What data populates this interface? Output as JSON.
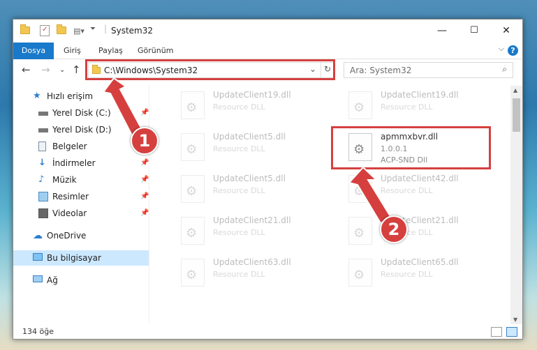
{
  "window": {
    "title": "System32",
    "minimize": "—",
    "maximize": "☐",
    "close": "✕"
  },
  "ribbon": {
    "tabs": [
      "Dosya",
      "Giriş",
      "Paylaş",
      "Görünüm"
    ],
    "help": "?"
  },
  "address": {
    "path": "C:\\Windows\\System32",
    "search_placeholder": "Ara: System32"
  },
  "sidebar": {
    "items": [
      {
        "label": "Hızlı erişim",
        "icon": "star-icon"
      },
      {
        "label": "Yerel Disk (C:)",
        "icon": "drive-icon",
        "pinned": true
      },
      {
        "label": "Yerel Disk (D:)",
        "icon": "drive-icon"
      },
      {
        "label": "Belgeler",
        "icon": "documents-icon",
        "pinned": true
      },
      {
        "label": "İndirmeler",
        "icon": "download-icon",
        "pinned": true
      },
      {
        "label": "Müzik",
        "icon": "music-icon",
        "pinned": true
      },
      {
        "label": "Resimler",
        "icon": "pictures-icon",
        "pinned": true
      },
      {
        "label": "Videolar",
        "icon": "videos-icon",
        "pinned": true
      },
      {
        "label": "OneDrive",
        "icon": "cloud-icon"
      },
      {
        "label": "Bu bilgisayar",
        "icon": "computer-icon",
        "selected": true
      },
      {
        "label": "Ağ",
        "icon": "network-icon"
      }
    ]
  },
  "files": [
    {
      "name": "UpdateClient19.dll",
      "desc": "Resource DLL"
    },
    {
      "name": "UpdateClient19.dll",
      "desc": "Resource DLL"
    },
    {
      "name": "UpdateClient5.dll",
      "desc": "Resource DLL"
    },
    {
      "name": "apmmxbvr.dll",
      "version": "1.0.0.1",
      "desc": "ACP-SND Dll"
    },
    {
      "name": "UpdateClient5.dll",
      "desc": "Resource DLL"
    },
    {
      "name": "UpdateClient42.dll",
      "desc": "Resource DLL"
    },
    {
      "name": "UpdateClient21.dll",
      "desc": "Resource DLL"
    },
    {
      "name": "UpdateClient21.dll",
      "desc": "Resource DLL"
    },
    {
      "name": "UpdateClient63.dll",
      "desc": "Resource DLL"
    },
    {
      "name": "UpdateClient65.dll",
      "desc": "Resource DLL"
    }
  ],
  "status": {
    "count": "134 öğe"
  },
  "annotations": {
    "badge1": "1",
    "badge2": "2"
  },
  "colors": {
    "accent": "#1979ca",
    "highlight": "#d5403f"
  }
}
